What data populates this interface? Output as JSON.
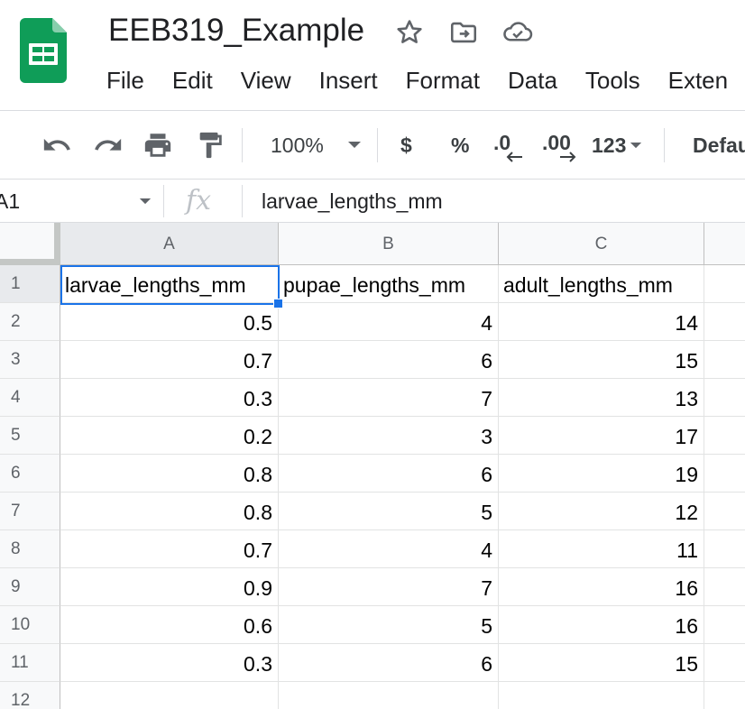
{
  "app": {
    "title": "EEB319_Example",
    "brand_color": "#0f9d58",
    "icons": [
      "star-icon",
      "move-to-folder-icon",
      "cloud-saved-icon"
    ]
  },
  "menu": [
    "File",
    "Edit",
    "View",
    "Insert",
    "Format",
    "Data",
    "Tools",
    "Exten"
  ],
  "toolbar": {
    "zoom": "100%",
    "currency": "$",
    "percent": "%",
    "decrease_decimals": ".0",
    "increase_decimals": ".00",
    "more_formats": "123",
    "font": "Defau"
  },
  "formula_bar": {
    "name_box": "A1",
    "fx": "fx",
    "value": "larvae_lengths_mm"
  },
  "sheet": {
    "columns": [
      "A",
      "B",
      "C"
    ],
    "row_numbers": [
      "1",
      "2",
      "3",
      "4",
      "5",
      "6",
      "7",
      "8",
      "9",
      "10",
      "11",
      "12"
    ],
    "header_row": [
      "larvae_lengths_mm",
      "pupae_lengths_mm",
      "adult_lengths_mm"
    ],
    "rows": [
      [
        "0.5",
        "4",
        "14"
      ],
      [
        "0.7",
        "6",
        "15"
      ],
      [
        "0.3",
        "7",
        "13"
      ],
      [
        "0.2",
        "3",
        "17"
      ],
      [
        "0.8",
        "6",
        "19"
      ],
      [
        "0.8",
        "5",
        "12"
      ],
      [
        "0.7",
        "4",
        "11"
      ],
      [
        "0.9",
        "7",
        "16"
      ],
      [
        "0.6",
        "5",
        "16"
      ],
      [
        "0.3",
        "6",
        "15"
      ]
    ],
    "selected_cell": "A1",
    "selection_color": "#1a73e8"
  }
}
